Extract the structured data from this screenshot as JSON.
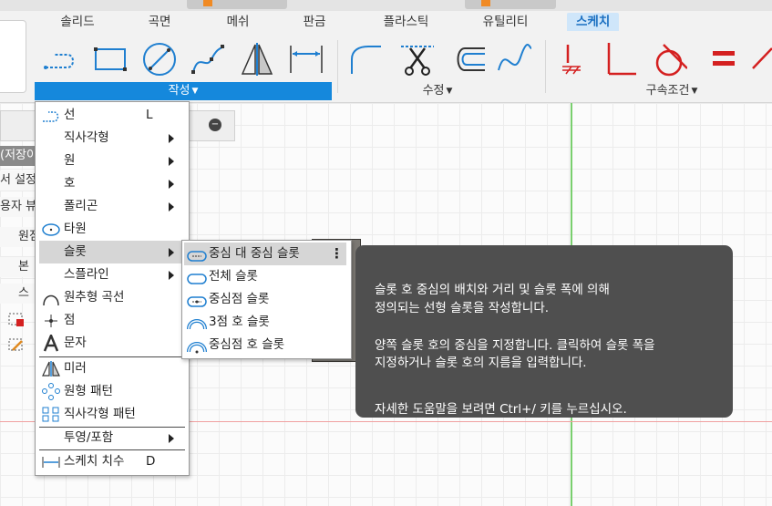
{
  "ribbon": {
    "tabs": [
      {
        "label": "솔리드",
        "active": false
      },
      {
        "label": "곡면",
        "active": false
      },
      {
        "label": "메쉬",
        "active": false
      },
      {
        "label": "판금",
        "active": false
      },
      {
        "label": "플라스틱",
        "active": false
      },
      {
        "label": "유틸리티",
        "active": false
      },
      {
        "label": "스케치",
        "active": true
      }
    ],
    "groups": {
      "create": "작성",
      "modify": "수정",
      "constraints": "구속조건"
    },
    "tools_create": [
      "line-tool-icon",
      "rectangle-tool-icon",
      "circle-tool-icon",
      "spline-tool-icon",
      "mirror-tool-icon",
      "dimension-tool-icon"
    ],
    "tools_modify": [
      "fillet-tool-icon",
      "trim-tool-icon",
      "offset-tool-icon",
      "curve-tool-icon"
    ],
    "tools_constraints": [
      "fix-constraint-icon",
      "perpendicular-constraint-icon",
      "tangent-constraint-icon",
      "equal-constraint-icon",
      "parallel-constraint-icon"
    ],
    "accent_color": "#1588dc"
  },
  "browser": {
    "rows": [
      "(저장이",
      "서 설정",
      "용자 뷰",
      "원점",
      "본",
      "스"
    ]
  },
  "create_menu": {
    "items": [
      {
        "label": "선",
        "shortcut": "L",
        "submenu": false
      },
      {
        "label": "직사각형",
        "shortcut": "",
        "submenu": true
      },
      {
        "label": "원",
        "shortcut": "",
        "submenu": true
      },
      {
        "label": "호",
        "shortcut": "",
        "submenu": true
      },
      {
        "label": "폴리곤",
        "shortcut": "",
        "submenu": true
      },
      {
        "label": "타원",
        "shortcut": "",
        "submenu": false
      },
      {
        "label": "슬롯",
        "shortcut": "",
        "submenu": true
      },
      {
        "label": "스플라인",
        "shortcut": "",
        "submenu": true
      },
      {
        "label": "원추형 곡선",
        "shortcut": "",
        "submenu": false
      },
      {
        "label": "점",
        "shortcut": "",
        "submenu": false
      },
      {
        "label": "문자",
        "shortcut": "",
        "submenu": false
      },
      {
        "label": "미러",
        "shortcut": "",
        "submenu": false
      },
      {
        "label": "원형 패턴",
        "shortcut": "",
        "submenu": false
      },
      {
        "label": "직사각형 패턴",
        "shortcut": "",
        "submenu": false
      },
      {
        "label": "투영/포함",
        "shortcut": "",
        "submenu": true
      },
      {
        "label": "스케치 치수",
        "shortcut": "D",
        "submenu": false
      }
    ]
  },
  "slot_menu": {
    "items": [
      {
        "label": "중심 대 중심 슬롯",
        "highlighted": true
      },
      {
        "label": "전체 슬롯",
        "highlighted": false
      },
      {
        "label": "중심점 슬롯",
        "highlighted": false
      },
      {
        "label": "3점 호 슬롯",
        "highlighted": false
      },
      {
        "label": "중심점 호 슬롯",
        "highlighted": false
      }
    ],
    "more_glyph": "⋮"
  },
  "tooltip": {
    "lines": [
      "슬롯 호 중심의 배치와 거리 및 슬롯 폭에 의해",
      "정의되는 선형 슬롯을 작성합니다.",
      "양쪽 슬롯 호의 중심을 지정합니다. 클릭하여 슬롯 폭을",
      "지정하거나 슬롯 호의 지름을 입력합니다.",
      "자세한 도움말을 보려면 Ctrl+/ 키를 누르십시오."
    ]
  }
}
